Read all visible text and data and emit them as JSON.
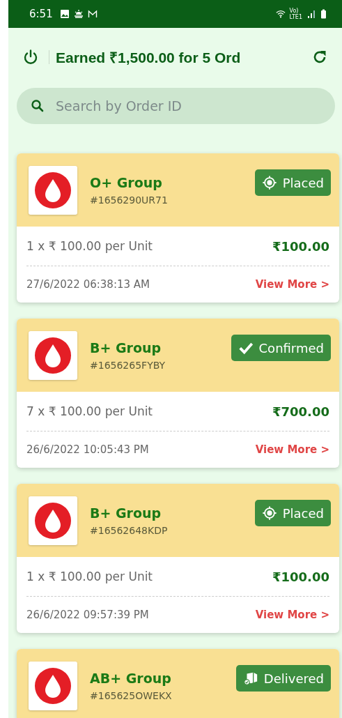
{
  "status_bar": {
    "time": "6:51",
    "network_label": [
      "Vo)",
      "LTE1"
    ]
  },
  "header": {
    "title": "Earned ₹1,500.00 for 5 Ord"
  },
  "search": {
    "placeholder": "Search by Order ID"
  },
  "orders": [
    {
      "group": "O+ Group",
      "order_id": "#1656290UR71",
      "status": {
        "kind": "placed",
        "label": "Placed"
      },
      "quantity": "1 x ₹ 100.00 per Unit",
      "total": "₹100.00",
      "date": "27/6/2022 06:38:13 AM",
      "link": "View More",
      "link_icon": ">"
    },
    {
      "group": "B+ Group",
      "order_id": "#1656265FYBY",
      "status": {
        "kind": "confirmed",
        "label": "Confirmed"
      },
      "quantity": "7 x ₹ 100.00 per Unit",
      "total": "₹700.00",
      "date": "26/6/2022 10:05:43 PM",
      "link": "View More",
      "link_icon": ">"
    },
    {
      "group": "B+ Group",
      "order_id": "#16562648KDP",
      "status": {
        "kind": "placed",
        "label": "Placed"
      },
      "quantity": "1 x ₹ 100.00 per Unit",
      "total": "₹100.00",
      "date": "26/6/2022 09:57:39 PM",
      "link": "View More",
      "link_icon": ">"
    },
    {
      "group": "AB+ Group",
      "order_id": "#165625OWEKX",
      "status": {
        "kind": "delivered",
        "label": "Delivered"
      }
    }
  ]
}
